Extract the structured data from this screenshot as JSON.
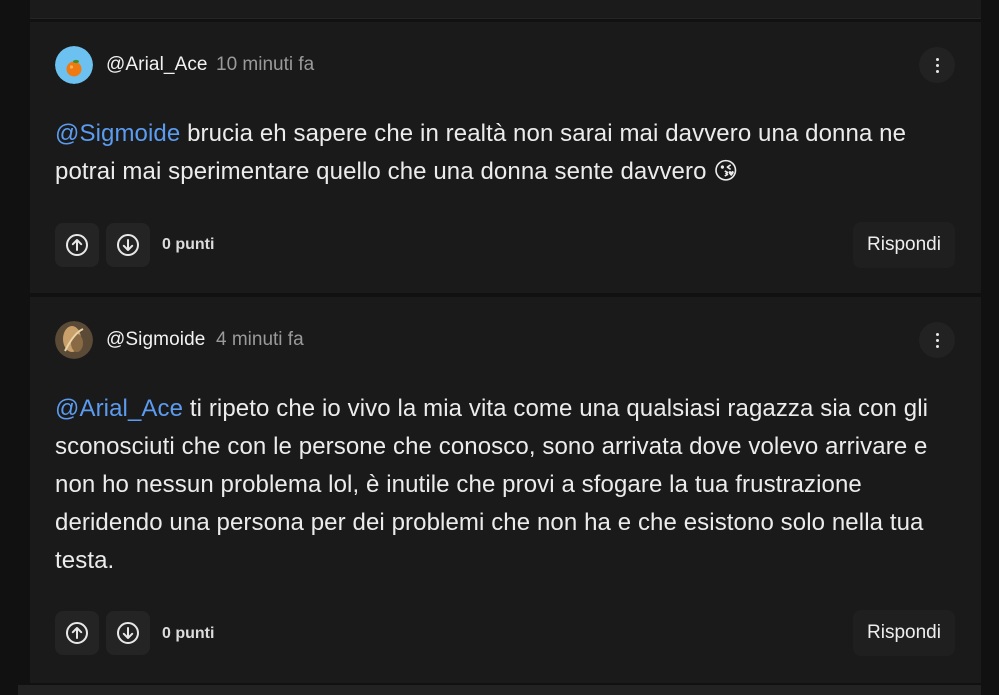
{
  "comments": [
    {
      "username": "@Arial_Ace",
      "time": "10 minuti fa",
      "mention": "@Sigmoide",
      "text": " brucia eh sapere che in realtà non sarai mai davvero una donna ne potrai mai sperimentare quello che una donna sente davvero 😘",
      "points": "0 punti",
      "reply_label": "Rispondi",
      "avatar_icon": "orange-fruit-avatar"
    },
    {
      "username": "@Sigmoide",
      "time": "4 minuti fa",
      "mention": "@Arial_Ace",
      "text": " ti ripeto che io vivo la mia vita come una qualsiasi ragazza sia con gli sconosciuti che con le persone che conosco, sono arrivata dove volevo arrivare e non ho nessun problema lol, è inutile che provi a sfogare la tua frustrazione deridendo una persona per dei problemi che non ha e che esistono solo nella tua testa.",
      "points": "0 punti",
      "reply_label": "Rispondi",
      "avatar_icon": "painting-avatar"
    }
  ],
  "colors": {
    "background": "#111111",
    "card": "#1a1a1a",
    "mention": "#5b9bf0",
    "muted": "#9a9a9a"
  }
}
